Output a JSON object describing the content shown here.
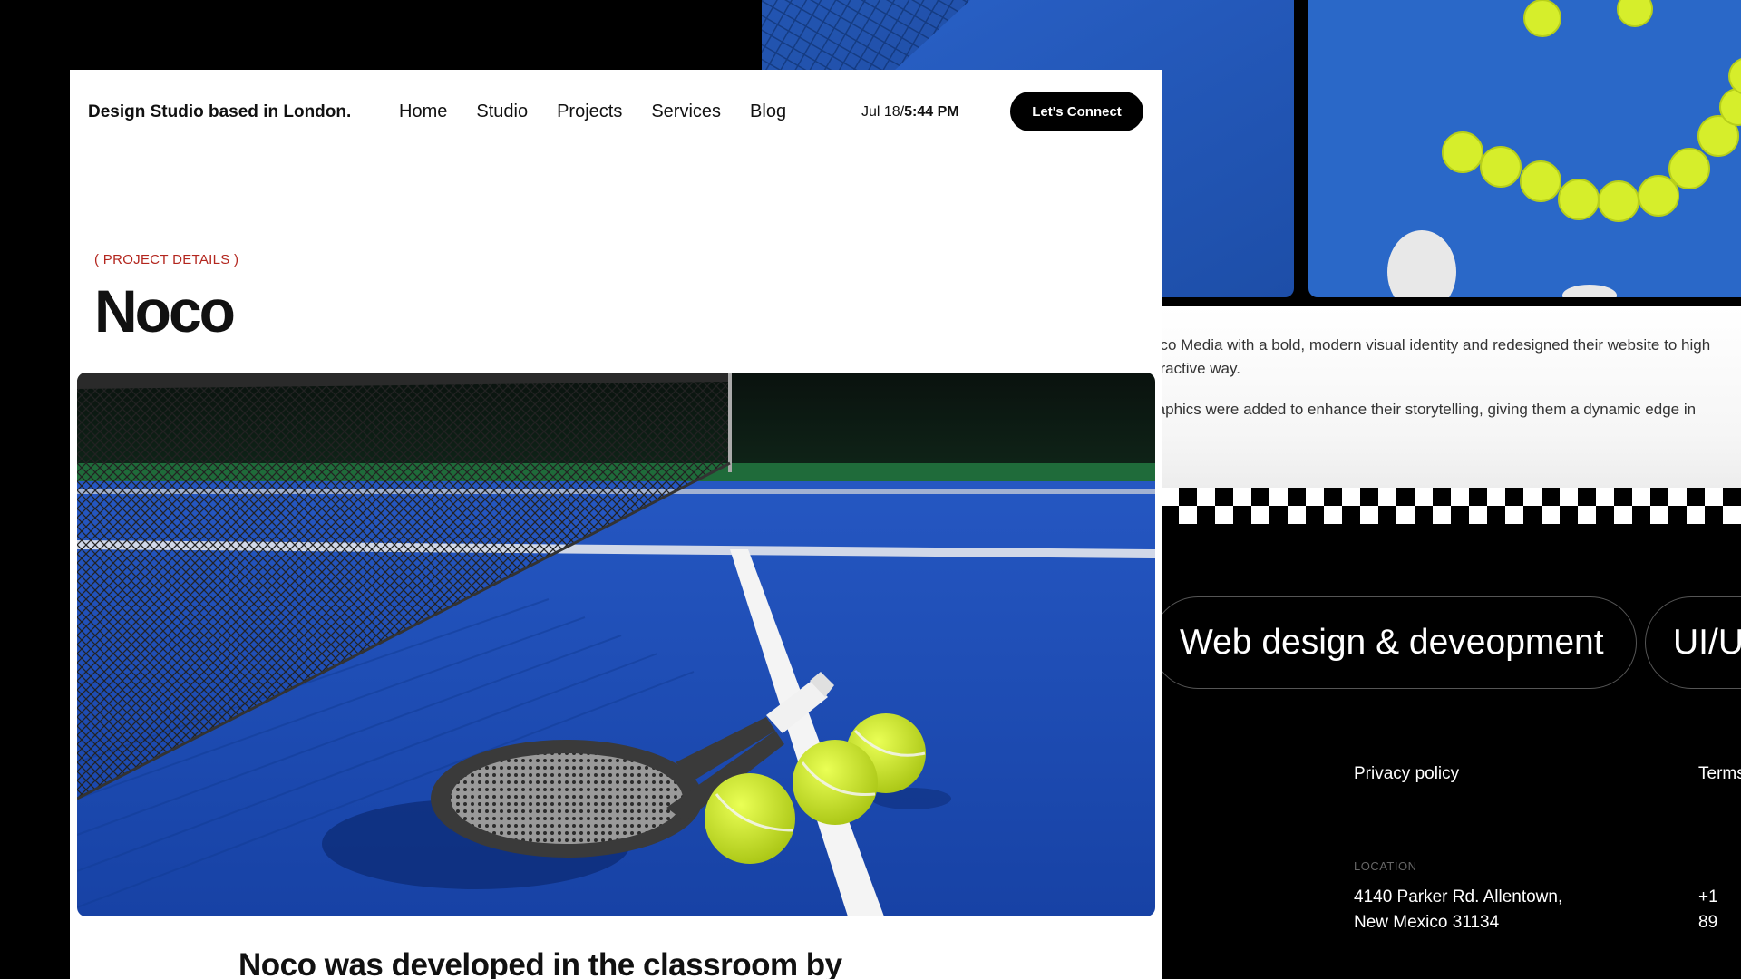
{
  "header": {
    "brand": "Design Studio based in London.",
    "nav": [
      "Home",
      "Studio",
      "Projects",
      "Services",
      "Blog"
    ],
    "date": "Jul 18/",
    "time": "5:44 PM",
    "cta": "Let's Connect"
  },
  "project": {
    "eyebrow": "( PROJECT DETAILS )",
    "title": "Noco",
    "hero_image": "tennis-court-racket-and-balls-photo",
    "intro": "Noco was developed in the classroom by"
  },
  "background_page": {
    "top_images": [
      "tennis-court-net-shadow-photo",
      "tennis-balls-smiley-photo"
    ],
    "para1_line1": "oco Media with a bold, modern visual identity and redesigned their website to high",
    "para1_line2": "eractive way.",
    "para2": "raphics were added to enhance their storytelling, giving them a dynamic edge in",
    "services": [
      "Web design & deveopment",
      "UI/U"
    ],
    "footer": {
      "privacy": "Privacy policy",
      "terms": "Terms",
      "location_label": "LOCATION",
      "address_line1": "4140 Parker Rd. Allentown,",
      "address_line2": "New Mexico 31134",
      "phone": "+1 89"
    }
  },
  "colors": {
    "accent_red": "#b3261e",
    "court_blue": "#1f4fbf",
    "ball_yellow": "#d6ee2b",
    "dark": "#000000"
  }
}
